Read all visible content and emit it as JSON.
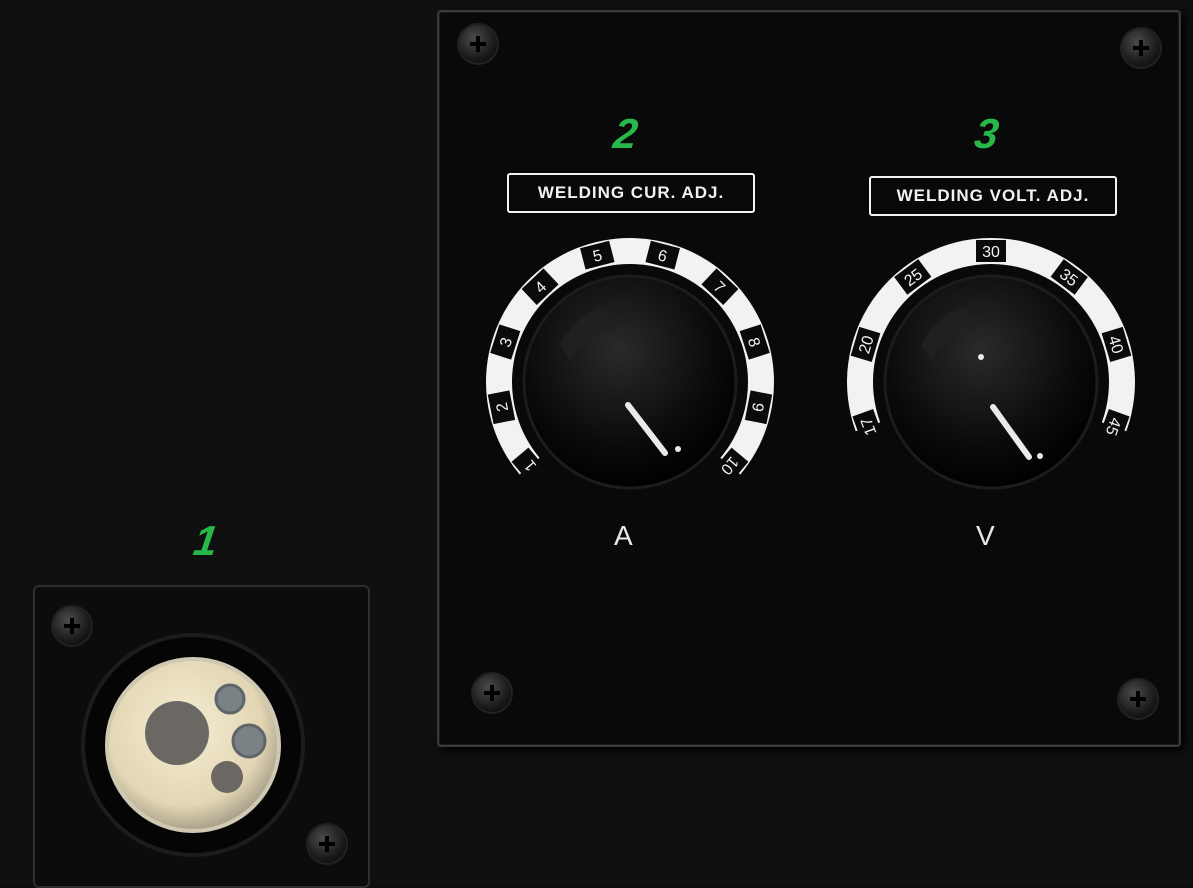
{
  "markers": {
    "socket": "1",
    "current": "2",
    "voltage": "3"
  },
  "current_knob": {
    "label": "WELDING CUR. ADJ.",
    "unit": "A",
    "scale": [
      "1",
      "2",
      "3",
      "4",
      "5",
      "6",
      "7",
      "8",
      "9",
      "10"
    ]
  },
  "voltage_knob": {
    "label": "WELDING VOLT. ADJ.",
    "unit": "V",
    "scale": [
      "17",
      "20",
      "25",
      "30",
      "35",
      "40",
      "45"
    ]
  },
  "colors": {
    "marker_green": "#27b84a",
    "panel": "#090909",
    "socket_insert": "#e3d6b4"
  },
  "icons": [
    "screw-icon"
  ]
}
